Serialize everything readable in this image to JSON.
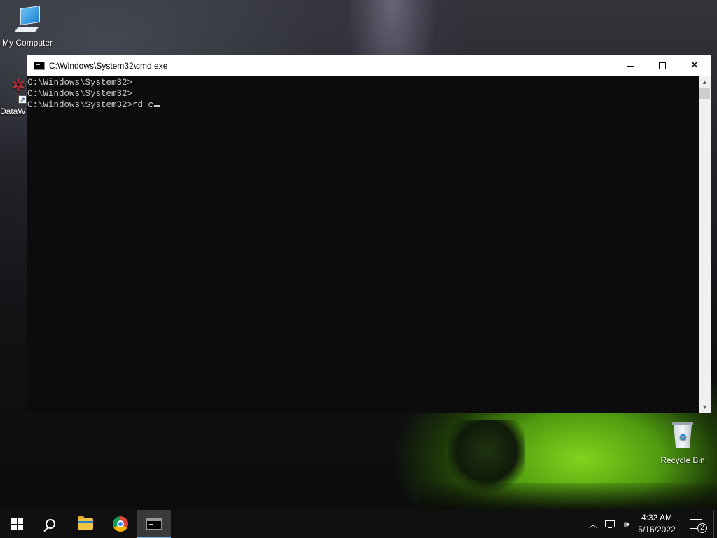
{
  "desktop": {
    "icons": [
      {
        "label": "My Computer"
      },
      {
        "label": "DataW"
      },
      {
        "label": "Recycle Bin"
      }
    ]
  },
  "window": {
    "title": "C:\\Windows\\System32\\cmd.exe",
    "console_lines": [
      "C:\\Windows\\System32>",
      "C:\\Windows\\System32>",
      "C:\\Windows\\System32>rd c"
    ]
  },
  "taskbar": {
    "apps": [
      "windows-start",
      "search",
      "file-explorer",
      "google-chrome",
      "command-prompt"
    ],
    "active_app": "command-prompt",
    "clock": {
      "time": "4:32 AM",
      "date": "5/16/2022"
    },
    "notification_count": "2"
  },
  "colors": {
    "console_bg": "#0c0c0c",
    "console_text": "#cccccc",
    "taskbar_bg": "#101010",
    "active_indicator": "#76b9ed"
  }
}
